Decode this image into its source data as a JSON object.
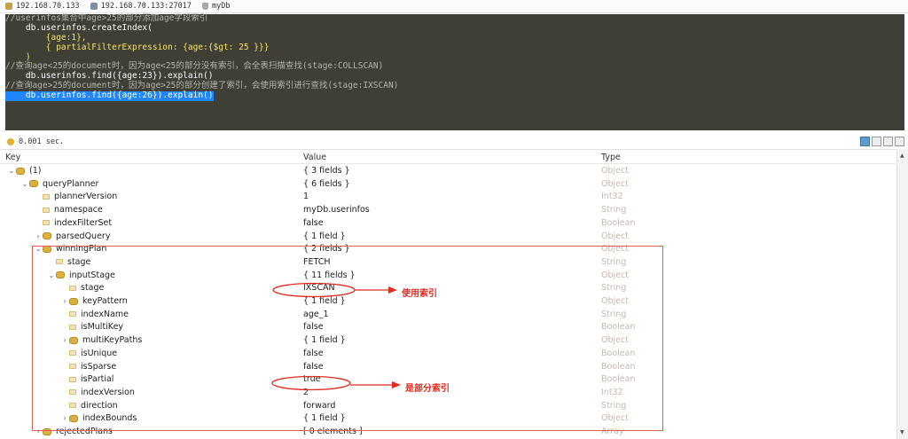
{
  "topbar": {
    "server": "192.168.70.133",
    "connection": "192.168.70.133:27017",
    "database": "myDb"
  },
  "editor": {
    "lines": [
      {
        "text": "//userinfos集合中age>25的部分添加age字段索引",
        "kind": "comment"
      },
      {
        "text": "    db.userinfos.createIndex(",
        "kind": "code"
      },
      {
        "text": "        {age:1},",
        "kind": "code-yellow"
      },
      {
        "text": "        { partialFilterExpression: {age:{$gt: 25 }}}",
        "kind": "code-yellow"
      },
      {
        "text": "    )",
        "kind": "code-yellow"
      },
      {
        "text": "//查询age<25的document时，因为age<25的部分没有索引，会全表扫描查找(stage:COLLSCAN)",
        "kind": "comment"
      },
      {
        "text": "    db.userinfos.find({age:23}).explain()",
        "kind": "code"
      },
      {
        "text": "//查询age>25的document时，因为age>25的部分创建了索引，会使用索引进行查找(stage:IXSCAN)",
        "kind": "comment"
      },
      {
        "text": "    db.userinfos.find({age:26}).explain()",
        "kind": "selected"
      }
    ]
  },
  "status": {
    "time": "0.001 sec."
  },
  "columns": {
    "key": "Key",
    "value": "Value",
    "type": "Type"
  },
  "rows": [
    {
      "key": "(1)",
      "value": "{ 3 fields }",
      "type": "Object",
      "indent": 0,
      "chev": "v",
      "icon": "obj"
    },
    {
      "key": "queryPlanner",
      "value": "{ 6 fields }",
      "type": "Object",
      "indent": 1,
      "chev": "v",
      "icon": "obj"
    },
    {
      "key": "plannerVersion",
      "value": "1",
      "type": "Int32",
      "indent": 2,
      "chev": "",
      "icon": "leaf"
    },
    {
      "key": "namespace",
      "value": "myDb.userinfos",
      "type": "String",
      "indent": 2,
      "chev": "",
      "icon": "leaf"
    },
    {
      "key": "indexFilterSet",
      "value": "false",
      "type": "Boolean",
      "indent": 2,
      "chev": "",
      "icon": "leaf"
    },
    {
      "key": "parsedQuery",
      "value": "{ 1 field }",
      "type": "Object",
      "indent": 2,
      "chev": ">",
      "icon": "obj"
    },
    {
      "key": "winningPlan",
      "value": "{ 2 fields }",
      "type": "Object",
      "indent": 2,
      "chev": "v",
      "icon": "obj"
    },
    {
      "key": "stage",
      "value": "FETCH",
      "type": "String",
      "indent": 3,
      "chev": "",
      "icon": "leaf"
    },
    {
      "key": "inputStage",
      "value": "{ 11 fields }",
      "type": "Object",
      "indent": 3,
      "chev": "v",
      "icon": "obj"
    },
    {
      "key": "stage",
      "value": "IXSCAN",
      "type": "String",
      "indent": 4,
      "chev": "",
      "icon": "leaf"
    },
    {
      "key": "keyPattern",
      "value": "{ 1 field }",
      "type": "Object",
      "indent": 4,
      "chev": ">",
      "icon": "obj"
    },
    {
      "key": "indexName",
      "value": "age_1",
      "type": "String",
      "indent": 4,
      "chev": "",
      "icon": "leaf"
    },
    {
      "key": "isMultiKey",
      "value": "false",
      "type": "Boolean",
      "indent": 4,
      "chev": "",
      "icon": "leaf"
    },
    {
      "key": "multiKeyPaths",
      "value": "{ 1 field }",
      "type": "Object",
      "indent": 4,
      "chev": ">",
      "icon": "obj"
    },
    {
      "key": "isUnique",
      "value": "false",
      "type": "Boolean",
      "indent": 4,
      "chev": "",
      "icon": "leaf"
    },
    {
      "key": "isSparse",
      "value": "false",
      "type": "Boolean",
      "indent": 4,
      "chev": "",
      "icon": "leaf"
    },
    {
      "key": "isPartial",
      "value": "true",
      "type": "Boolean",
      "indent": 4,
      "chev": "",
      "icon": "leaf"
    },
    {
      "key": "indexVersion",
      "value": "2",
      "type": "Int32",
      "indent": 4,
      "chev": "",
      "icon": "leaf"
    },
    {
      "key": "direction",
      "value": "forward",
      "type": "String",
      "indent": 4,
      "chev": "",
      "icon": "leaf"
    },
    {
      "key": "indexBounds",
      "value": "{ 1 field }",
      "type": "Object",
      "indent": 4,
      "chev": ">",
      "icon": "obj"
    },
    {
      "key": "rejectedPlans",
      "value": "[ 0 elements ]",
      "type": "Array",
      "indent": 2,
      "chev": ">",
      "icon": "obj"
    }
  ],
  "annotations": {
    "ixscan": "使用索引",
    "partial": "是部分索引"
  },
  "colors": {
    "annotation": "#e02c20",
    "selection": "#1f86ff",
    "editor_bg": "#403f35"
  }
}
